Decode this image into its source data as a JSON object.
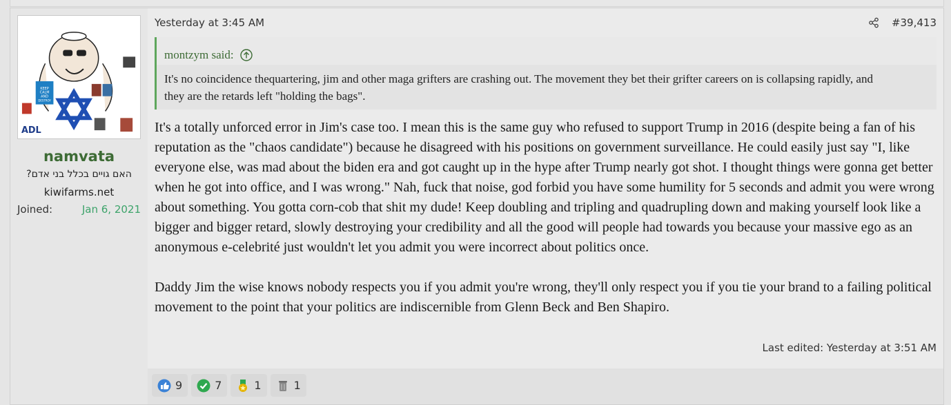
{
  "post": {
    "timestamp": "Yesterday at 3:45 AM",
    "number": "#39,413",
    "share_icon": "share-icon",
    "last_edited": "Last edited: Yesterday at 3:51 AM"
  },
  "user": {
    "name": "namvata",
    "title": "האם גויים בכלל בני אדם?",
    "site": "kiwifarms.net",
    "joined_label": "Joined:",
    "joined_date": "Jan 6, 2021",
    "avatar_icon": "avatar-image",
    "avatar_text": [
      "KEEP",
      "CALM",
      "AND",
      "DESTROY",
      "HAMAS",
      "ADL"
    ]
  },
  "quote": {
    "author": "montzym said:",
    "text": "It's no coincidence thequartering, jim and other maga grifters are crashing out. The movement they bet their grifter careers on is collapsing rapidly, and they are the retards left \"holding the bags\"."
  },
  "body": {
    "p1": "It's a totally unforced error in Jim's case too. I mean this is the same guy who refused to support Trump in 2016 (despite being a fan of his reputation as the \"chaos candidate\") because he disagreed with his positions on government surveillance. He could easily just say \"I, like everyone else, was mad about the biden era and got caught up in the hype after Trump nearly got shot. I thought things were gonna get better when he got into office, and I was wrong.\" Nah, fuck that noise, god forbid you have some humility for 5 seconds and admit you were wrong about something. You gotta corn-cob that shit my dude! Keep doubling and tripling and quadrupling down and making yourself look like a bigger and bigger retard, slowly destroying your credibility and all the good will people had towards you because your massive ego as an anonymous e-celebrité just wouldn't let you admit you were incorrect about politics once.",
    "p2": "Daddy Jim the wise knows nobody respects you if you admit you're wrong, they'll only respect you if you tie your brand to a failing political movement to the point that your politics are indiscernible from Glenn Beck and Ben Shapiro."
  },
  "reactions": [
    {
      "icon": "like-icon",
      "count": "9",
      "color": "#3b82d6"
    },
    {
      "icon": "agree-icon",
      "count": "7",
      "color": "#2fa84f"
    },
    {
      "icon": "winner-icon",
      "count": "1",
      "color": "#e5b400"
    },
    {
      "icon": "trash-icon",
      "count": "1",
      "color": "#8a8a8a"
    }
  ],
  "colors": {
    "username": "#3d6b35",
    "joined_date": "#3da36a",
    "quote_border": "#5ea65c"
  }
}
